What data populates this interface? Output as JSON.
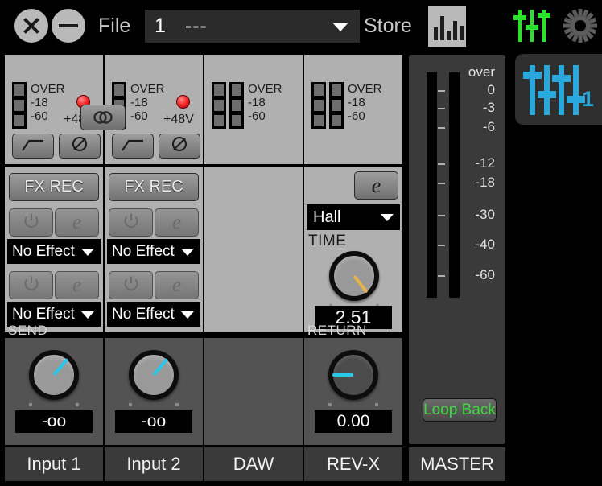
{
  "window": {
    "close_icon": "close-x-icon",
    "minimize_icon": "minimize-icon"
  },
  "topbar": {
    "file_label": "File",
    "file_number": "1",
    "file_name": "---",
    "store_label": "Store",
    "meter_view_icon": "meter-bars-icon",
    "mixer_view_icon": "mixer-faders-icon",
    "settings_icon": "gear-icon",
    "dropdown_arrow_icon": "chevron-down-icon"
  },
  "link_button": {
    "icon": "link-chain-icon"
  },
  "meter_scale": {
    "over": "OVER",
    "mid": "-18",
    "low": "-60"
  },
  "phantom": {
    "label": "+48V",
    "state": "on"
  },
  "preamp_buttons": {
    "hpf_icon": "highpass-filter-icon",
    "polarity_icon": "phase-invert-icon"
  },
  "channels": [
    {
      "name": "Input 1",
      "meter_type": "mono",
      "has_preamp": true,
      "fx": {
        "rec_label": "FX REC",
        "slots": [
          {
            "power_icon": "power-icon",
            "edit_icon": "edit-e-icon",
            "effect": "No Effect"
          },
          {
            "power_icon": "power-icon",
            "edit_icon": "edit-e-icon",
            "effect": "No Effect"
          }
        ]
      },
      "send": {
        "label": "SEND",
        "value": "-oo",
        "pointer_angle": -140,
        "knob_style": "light"
      }
    },
    {
      "name": "Input 2",
      "meter_type": "mono",
      "has_preamp": true,
      "fx": {
        "rec_label": "FX REC",
        "slots": [
          {
            "power_icon": "power-icon",
            "edit_icon": "edit-e-icon",
            "effect": "No Effect"
          },
          {
            "power_icon": "power-icon",
            "edit_icon": "edit-e-icon",
            "effect": "No Effect"
          }
        ]
      },
      "send": {
        "label": "",
        "value": "-oo",
        "pointer_angle": -140,
        "knob_style": "light"
      }
    },
    {
      "name": "DAW",
      "meter_type": "stereo",
      "has_preamp": false,
      "fx": null,
      "send": null
    },
    {
      "name": "REV-X",
      "meter_type": "stereo",
      "has_preamp": false,
      "revx": {
        "edit_icon": "edit-e-icon",
        "program": "Hall",
        "time_label": "TIME",
        "time_value": "2.51",
        "pointer_angle": -38,
        "knob_style": "light"
      },
      "send": {
        "label": "RETURN",
        "value": "0.00",
        "pointer_angle": 90,
        "knob_style": "dark"
      }
    }
  ],
  "master": {
    "name": "MASTER",
    "scale": [
      "over",
      "0",
      "-3",
      "-6",
      "-12",
      "-18",
      "-30",
      "-40",
      "-60"
    ],
    "loop_back_label": "Loop Back"
  },
  "sidebar": {
    "layer_icon": "mixer-faders-icon",
    "layer_number": "1"
  },
  "colors": {
    "panel_light": "#b0b0b0",
    "panel_dark": "#3a3a3a",
    "accent_cyan": "#29c8e8",
    "accent_green": "#3ddb3d",
    "accent_orange": "#e8b34a",
    "phantom_red": "#f02020"
  }
}
